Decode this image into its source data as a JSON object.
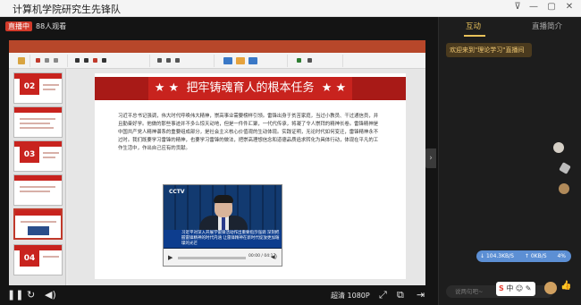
{
  "window": {
    "title": "计算机学院研究生先锋队",
    "controls": [
      "pin",
      "minimize",
      "maximize",
      "close"
    ]
  },
  "live": {
    "status": "直播中",
    "viewers": "88人观看"
  },
  "slide": {
    "title": "把牢铸魂育人的根本任务",
    "stars_left": "★ ★",
    "stars_right": "★ ★",
    "paragraph": "习近平总书记强调，伟大时代呼唤伟大精神，崇高事业需要榜样引领。雷锋出身于贫苦家庭，当过小教员、干过通信员，并且勤奋好学。他做的那些事迹并不多么惊天动地，但是一件件汇聚，一代代传承，将凝了令人崇拜的精神长卷。雷锋精神是中国共产党人精神谱系的重要组成部分，是社会主义核心价值观的生动体现。实践证明，无论时代如何变迁，雷锋精神永不过时。我们既要学习雷锋的精神，也要学习雷锋的做法，把崇高理想信念和道德品质追求转化为具体行动，体现在平凡的工作生活中，作出自己应有的贡献。",
    "video": {
      "channel": "CCTV",
      "news_caption": "习近平对深入开展学雷锋活动作出重要指示强调 深刻把握雷锋精神的时代内涵 让雷锋精神在新时代绽放更加璀璨的光芒",
      "time": "00:00 / 04:17"
    },
    "thumb_numbers": [
      "02",
      "03",
      "04"
    ]
  },
  "controls": {
    "quality": "超清 1080P"
  },
  "panel": {
    "tabs": [
      "互动",
      "直播简介"
    ],
    "active_tab": 0,
    "welcome": "欢迎来到\"理论学习\"直播间",
    "speed_down": "104.3KB/S",
    "speed_up": "0KB/S",
    "speed_pct": "4%",
    "input_placeholder": "说两句吧~",
    "ime_label": "中"
  },
  "colors": {
    "accent": "#e8c15a",
    "live_red": "#d23a2a",
    "slide_red": "#c8231e",
    "speed_blue": "#5c8fd4"
  }
}
